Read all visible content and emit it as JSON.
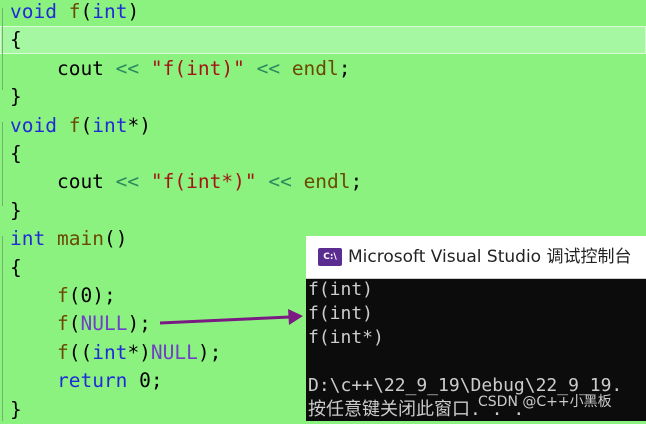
{
  "editor": {
    "lines": [
      {
        "segments": [
          {
            "t": "void",
            "c": "kw"
          },
          {
            "t": " ",
            "c": ""
          },
          {
            "t": "f",
            "c": "fn"
          },
          {
            "t": "(",
            "c": ""
          },
          {
            "t": "int",
            "c": "kw"
          },
          {
            "t": ")",
            "c": ""
          }
        ]
      },
      {
        "current": true,
        "segments": [
          {
            "t": "{",
            "c": ""
          }
        ]
      },
      {
        "segments": [
          {
            "t": "    cout ",
            "c": ""
          },
          {
            "t": "<<",
            "c": "op"
          },
          {
            "t": " ",
            "c": ""
          },
          {
            "t": "\"f(int)\"",
            "c": "str"
          },
          {
            "t": " ",
            "c": ""
          },
          {
            "t": "<<",
            "c": "op"
          },
          {
            "t": " ",
            "c": ""
          },
          {
            "t": "endl",
            "c": "fn"
          },
          {
            "t": ";",
            "c": ""
          }
        ]
      },
      {
        "segments": [
          {
            "t": "}",
            "c": ""
          }
        ]
      },
      {
        "segments": [
          {
            "t": "void",
            "c": "kw"
          },
          {
            "t": " ",
            "c": ""
          },
          {
            "t": "f",
            "c": "fn"
          },
          {
            "t": "(",
            "c": ""
          },
          {
            "t": "int",
            "c": "kw"
          },
          {
            "t": "*)",
            "c": ""
          }
        ]
      },
      {
        "segments": [
          {
            "t": "{",
            "c": ""
          }
        ]
      },
      {
        "segments": [
          {
            "t": "    cout ",
            "c": ""
          },
          {
            "t": "<<",
            "c": "op"
          },
          {
            "t": " ",
            "c": ""
          },
          {
            "t": "\"f(int*)\"",
            "c": "str"
          },
          {
            "t": " ",
            "c": ""
          },
          {
            "t": "<<",
            "c": "op"
          },
          {
            "t": " ",
            "c": ""
          },
          {
            "t": "endl",
            "c": "fn"
          },
          {
            "t": ";",
            "c": ""
          }
        ]
      },
      {
        "segments": [
          {
            "t": "}",
            "c": ""
          }
        ]
      },
      {
        "segments": [
          {
            "t": "int",
            "c": "kw"
          },
          {
            "t": " ",
            "c": ""
          },
          {
            "t": "main",
            "c": "fn"
          },
          {
            "t": "()",
            "c": ""
          }
        ]
      },
      {
        "segments": [
          {
            "t": "{",
            "c": ""
          }
        ]
      },
      {
        "segments": [
          {
            "t": "    ",
            "c": ""
          },
          {
            "t": "f",
            "c": "fn"
          },
          {
            "t": "(",
            "c": ""
          },
          {
            "t": "0",
            "c": "num"
          },
          {
            "t": ");",
            "c": ""
          }
        ]
      },
      {
        "segments": [
          {
            "t": "    ",
            "c": ""
          },
          {
            "t": "f",
            "c": "fn"
          },
          {
            "t": "(",
            "c": ""
          },
          {
            "t": "NULL",
            "c": "mac"
          },
          {
            "t": ");",
            "c": ""
          }
        ]
      },
      {
        "segments": [
          {
            "t": "    ",
            "c": ""
          },
          {
            "t": "f",
            "c": "fn"
          },
          {
            "t": "((",
            "c": ""
          },
          {
            "t": "int",
            "c": "kw"
          },
          {
            "t": "*)",
            "c": ""
          },
          {
            "t": "NULL",
            "c": "mac"
          },
          {
            "t": ");",
            "c": ""
          }
        ]
      },
      {
        "segments": [
          {
            "t": "    ",
            "c": ""
          },
          {
            "t": "return",
            "c": "kw"
          },
          {
            "t": " ",
            "c": ""
          },
          {
            "t": "0",
            "c": "num"
          },
          {
            "t": ";",
            "c": ""
          }
        ]
      },
      {
        "segments": [
          {
            "t": "}",
            "c": ""
          }
        ]
      }
    ]
  },
  "console": {
    "icon_text": "C:\\",
    "title": "Microsoft Visual Studio 调试控制台",
    "output": [
      "f(int)",
      "f(int)",
      "f(int*)",
      "",
      "D:\\c++\\22_9_19\\Debug\\22_9_19.",
      "按任意键关闭此窗口. . ."
    ]
  },
  "watermark": "CSDN @C++小黑板",
  "colors": {
    "editor_background": "#8cf27f",
    "current_line": "#a6f7a2",
    "console_background": "#0c0c0c",
    "console_text": "#cccccc",
    "arrow": "#7a1a82"
  }
}
